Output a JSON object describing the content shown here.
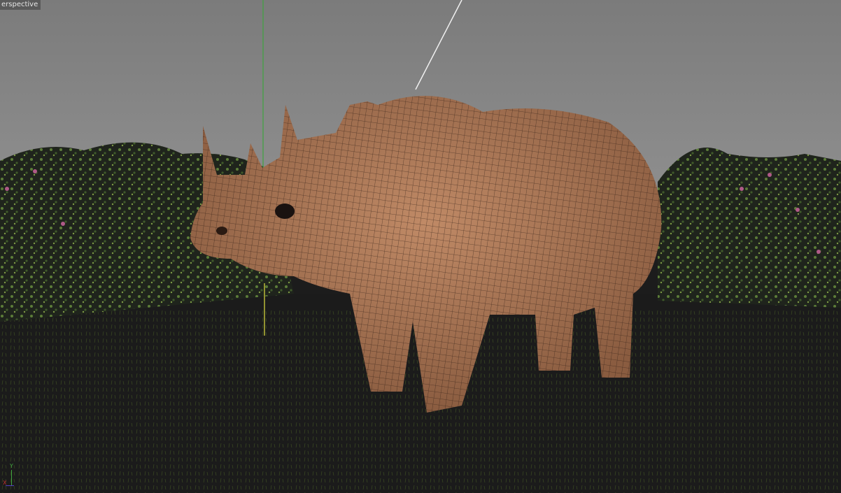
{
  "viewport": {
    "camera_label": "erspective",
    "axes": {
      "y": "Y",
      "x": "X"
    },
    "colors": {
      "sky": "#8a8a8a",
      "ground": "#1b1b1b",
      "skin": "#b07a58",
      "foliage": "#5a7a3a",
      "flower": "#b05a88",
      "y_axis": "#3fa33f",
      "x_axis": "#c03030"
    }
  }
}
